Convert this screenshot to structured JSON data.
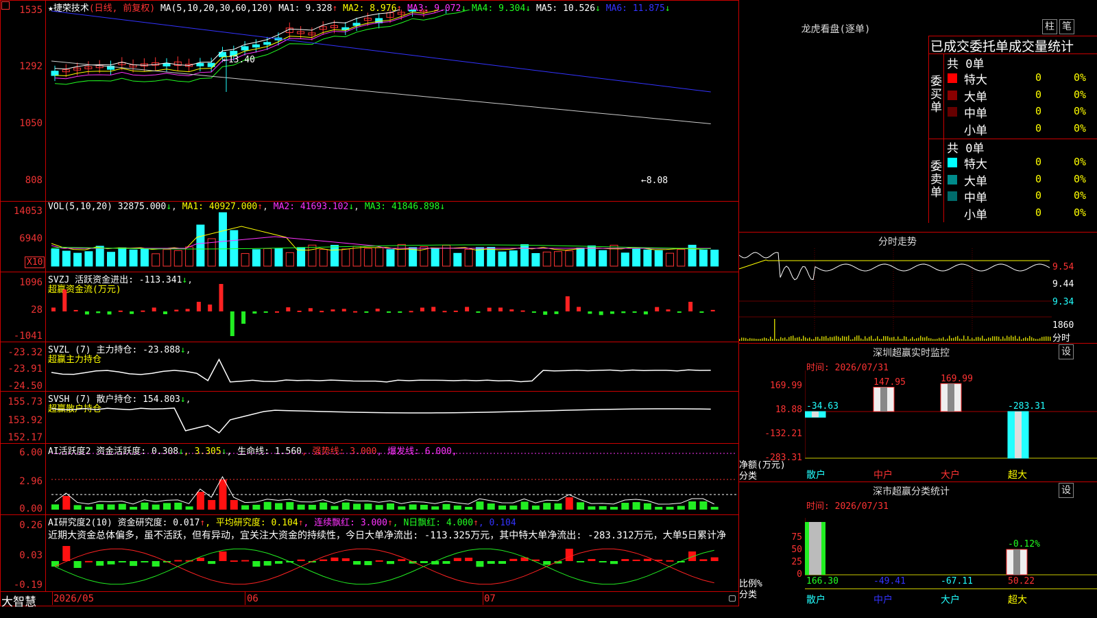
{
  "stock": {
    "star": "★",
    "name": "捷荣技术",
    "period": "(日线, 前复权)"
  },
  "ma_header": {
    "label": "MA(5,10,20,30,60,120)",
    "ma1": "MA1: 9.328",
    "ma2": "MA2: 8.976",
    "ma3": "MA3: 9.072",
    "ma4": "MA4: 9.304",
    "ma5": "MA5: 10.526",
    "ma6": "MA6: 11.875"
  },
  "price_axis": [
    "1535",
    "1292",
    "1050",
    "808"
  ],
  "price_annot": {
    "high": "13.40",
    "low": "8.08"
  },
  "vol_header": {
    "label": "VOL(5,10,20)",
    "vol": "32875.000",
    "ma1": "MA1: 40927.000",
    "ma2": "MA2: 41693.102",
    "ma3": "MA3: 41846.898"
  },
  "vol_axis": [
    "14053",
    "6940"
  ],
  "vol_unit": "X10",
  "svzj": {
    "label": "SVZJ  活跃资金进出: -113.341",
    "sub": "超赢资金流(万元)",
    "axis": [
      "1096",
      "28",
      "-1041"
    ]
  },
  "svzl": {
    "label": "SVZL (7) 主力持仓: -23.888",
    "sub": "超赢主力持仓",
    "axis": [
      "-23.32",
      "-23.91",
      "-24.50"
    ]
  },
  "svsh": {
    "label": "SVSH (7) 散户持仓: 154.803",
    "sub": "超赢散户持仓",
    "axis": [
      "155.73",
      "153.92",
      "152.17"
    ]
  },
  "ai2": {
    "label": "AI活跃度2 资金活跃度: 0.308",
    "v2": ", 3.305",
    "life": ", 生命线: 1.560",
    "strong": ", 强势线: 3.000",
    "burst": ", 爆发线: 6.000,",
    "axis": [
      "6.00",
      "2.96",
      "0.00"
    ]
  },
  "ai_research": {
    "label": "AI研究度2(10) 资金研究度: 0.017",
    "avg": ", 平均研究度: 0.104",
    "lianxu": ", 连续飘红: 3.000",
    "nday": ", N日飘红: 4.000",
    "last": ", 0.104",
    "axis": [
      "0.26",
      "0.03",
      "-0.19"
    ],
    "text": "近期大资金总体偏多，虽不活跃，但有异动，宜关注大资金的持续性，今日大单净流出: -113.325万元，其中特大单净流出: -283.312万元，大单5日累计净"
  },
  "bottom": {
    "brand": "大智慧",
    "d1": "2026/05",
    "d2": "06",
    "d3": "07"
  },
  "right": {
    "lh_title": "龙虎看盘(逐单)",
    "btn1": "柱",
    "btn2": "笔",
    "stat_header": "已成交委托单成交量统计",
    "buy": {
      "side": "委买单",
      "total": "共 0单",
      "rows": [
        {
          "name": "特大",
          "v": "0",
          "p": "0%",
          "c": "#ff0000"
        },
        {
          "name": "大单",
          "v": "0",
          "p": "0%",
          "c": "#8b0000"
        },
        {
          "name": "中单",
          "v": "0",
          "p": "0%",
          "c": "#660000"
        },
        {
          "name": "小单",
          "v": "0",
          "p": "0%",
          "c": "#000000"
        }
      ]
    },
    "sell": {
      "side": "委卖单",
      "total": "共 0单",
      "rows": [
        {
          "name": "特大",
          "v": "0",
          "p": "0%",
          "c": "#00ffff"
        },
        {
          "name": "大单",
          "v": "0",
          "p": "0%",
          "c": "#008b8b"
        },
        {
          "name": "中单",
          "v": "0",
          "p": "0%",
          "c": "#006b6b"
        },
        {
          "name": "小单",
          "v": "0",
          "p": "0%",
          "c": "#000000"
        }
      ]
    },
    "intraday": {
      "title": "分时走势",
      "a1": "9.54",
      "a2": "9.44",
      "a3": "9.34",
      "v": "1860",
      "unit": "分时"
    },
    "monitor": {
      "title": "深圳超赢实时监控",
      "set": "设",
      "time": "时间: 2026/07/31",
      "axis": [
        "169.99",
        "18.88",
        "-132.21",
        "-283.31"
      ],
      "labels": [
        "-34.63",
        "147.95",
        "169.99",
        "-283.31"
      ],
      "cats": [
        "散户",
        "中户",
        "大户",
        "超大"
      ],
      "unit1": "净额(万元)",
      "unit2": "分类"
    },
    "classify": {
      "title": "深市超赢分类统计",
      "set": "设",
      "time": "时间: 2026/07/31",
      "axis": [
        "75",
        "50",
        "25",
        "0"
      ],
      "top": "-0.12%",
      "vals": [
        "166.30",
        "-49.41",
        "-67.11",
        "50.22"
      ],
      "cats": [
        "散户",
        "中户",
        "大户",
        "超大"
      ],
      "unit1": "比例%",
      "unit2": "分类"
    }
  }
}
